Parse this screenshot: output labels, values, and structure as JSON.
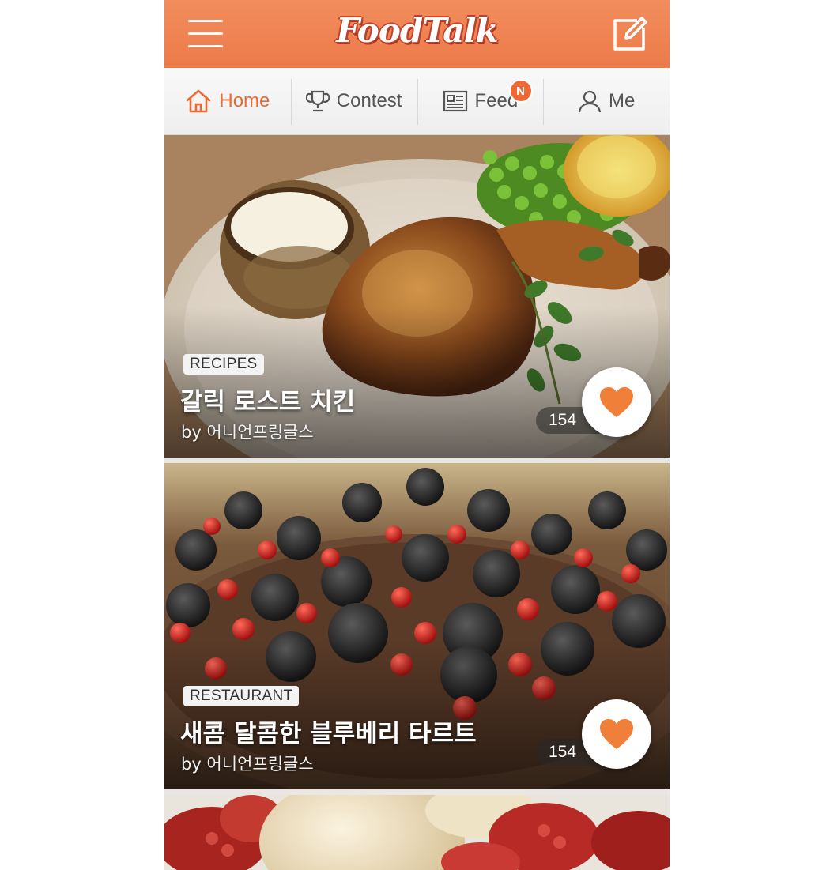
{
  "header": {
    "logo_text": "FoodTalk",
    "menu_icon": "hamburger-icon",
    "compose_icon": "edit-icon"
  },
  "tabs": [
    {
      "label": "Home",
      "icon": "home-icon",
      "active": true
    },
    {
      "label": "Contest",
      "icon": "trophy-icon",
      "active": false
    },
    {
      "label": "Feed",
      "icon": "newspaper-icon",
      "active": false,
      "badge": "N"
    },
    {
      "label": "Me",
      "icon": "user-icon",
      "active": false
    }
  ],
  "cards": [
    {
      "category": "RECIPES",
      "title": "갈릭 로스트 치킨",
      "author": "by 어니언프링글스",
      "likes": "154",
      "image": "roast-chicken-plate"
    },
    {
      "category": "RESTAURANT",
      "title": "새콤 달콤한 블루베리 타르트",
      "author": "by 어니언프링글스",
      "likes": "154",
      "image": "berry-tart"
    },
    {
      "image": "ice-cream-raspberries"
    }
  ],
  "colors": {
    "brand": "#ee7a49",
    "active_tab": "#e86a35",
    "heart": "#f08039"
  }
}
